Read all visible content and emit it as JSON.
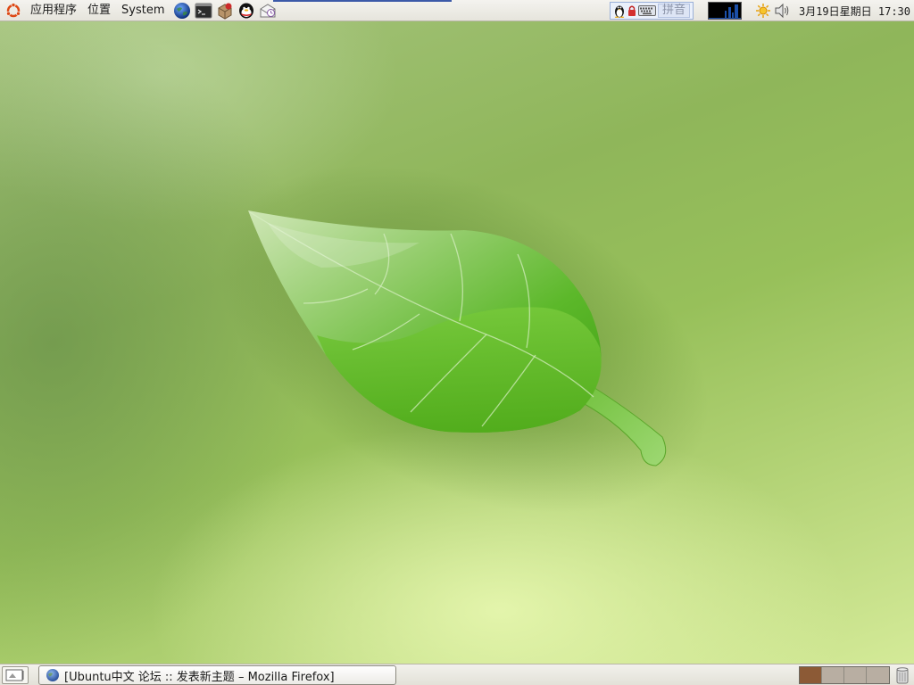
{
  "top_panel": {
    "menus": [
      {
        "label": "应用程序"
      },
      {
        "label": "位置"
      },
      {
        "label": "System"
      }
    ],
    "launchers": [
      "web-browser-icon",
      "terminal-icon",
      "package-manager-icon",
      "qq-messenger-icon",
      "mail-icon"
    ],
    "ime": {
      "icons": [
        "tux-icon",
        "lock-icon",
        "keyboard-icon"
      ],
      "mode_label": "拼音"
    },
    "tray": [
      "weather-icon",
      "volume-icon"
    ],
    "clock": "3月19日星期日 17:30"
  },
  "taskbar": {
    "window_title": "[Ubuntu中文 论坛 :: 发表新主题 – Mozilla Firefox]"
  },
  "workspaces": {
    "count": 4,
    "active_index": 0,
    "colors": [
      "#8c5a36",
      "#b8aea2",
      "#b8aea2",
      "#b8aea2"
    ]
  },
  "colors": {
    "panel": "#eceae3",
    "accent": "#3c5aa8",
    "leaf": "#5cb82a"
  }
}
